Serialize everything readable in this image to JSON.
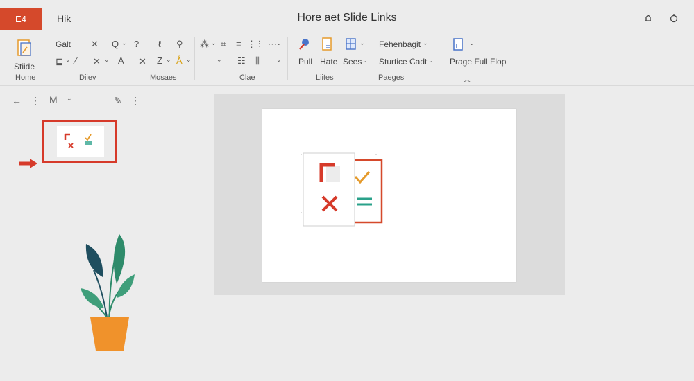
{
  "titlebar": {
    "app_badge": "E4",
    "file_tab": "Hik",
    "title": "Hore aet Slide Links"
  },
  "ribbon": {
    "home_big_label": "Stiide",
    "groups": {
      "home": "Home",
      "g1": "Diiev",
      "g2": "Mosaes",
      "g3": "Clae",
      "g4": "Liites",
      "g5": "Paeges"
    },
    "row1_text": "Galt",
    "labels": {
      "pull": "Pull",
      "hate": "Hate",
      "sees": "Sees",
      "fehenbagit": "Fehenbagit",
      "sturtice_cadt": "Sturtice Cadt",
      "prage_full_flop": "Prage Full Flop"
    },
    "glyph_a": "A"
  },
  "colors": {
    "accent_red": "#d63a2a",
    "badge_red": "#d5492b",
    "check_orange": "#e59a2b",
    "teal": "#2aa18a",
    "plant_pot": "#f0922b",
    "leaf_dark": "#1f4e5f",
    "leaf_green": "#2e8b6a"
  },
  "icons": [
    "share-icon",
    "settings-icon",
    "back-arrow-icon",
    "pen-icon",
    "arrow-right-icon"
  ]
}
